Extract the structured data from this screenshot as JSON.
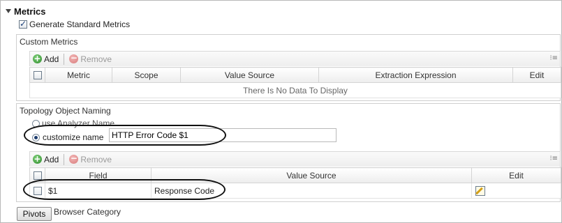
{
  "metrics": {
    "title": "Metrics",
    "generate_label": "Generate Standard Metrics",
    "generate_checked": true
  },
  "custom_metrics": {
    "title": "Custom Metrics",
    "toolbar": {
      "add_label": "Add",
      "remove_label": "Remove"
    },
    "columns": [
      "Metric",
      "Scope",
      "Value Source",
      "Extraction Expression",
      "Edit"
    ],
    "empty_text": "There Is No Data To Display"
  },
  "topology": {
    "title": "Topology Object Naming",
    "use_analyzer_label": "use Analyzer Name",
    "customize_label": "customize name",
    "customize_value": "HTTP Error Code $1",
    "selected": "customize",
    "toolbar": {
      "add_label": "Add",
      "remove_label": "Remove"
    },
    "columns": [
      "Field",
      "Value Source",
      "Edit"
    ],
    "rows": [
      {
        "field": "$1",
        "value_source": "Response Code",
        "edit_icon": "edit-pencil-icon"
      }
    ]
  },
  "bottom": {
    "pivots_label": "Pivots",
    "browser_category_label": "Browser Category"
  },
  "colors": {
    "add_green": "#2e8b2a",
    "remove_red": "#d77b7b",
    "annotation_oval": "#111111"
  }
}
